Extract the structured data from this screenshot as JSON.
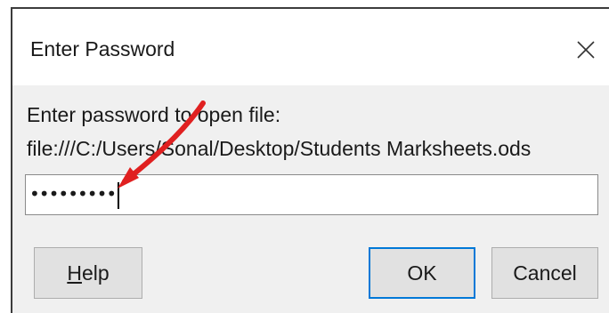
{
  "dialog": {
    "title": "Enter Password",
    "close_icon": "close-icon",
    "prompt": "Enter password to open file:",
    "file_path": "file:///C:/Users/Sonal/Desktop/Students Marksheets.ods",
    "password_value": "•••••••••",
    "buttons": {
      "help_first": "H",
      "help_rest": "elp",
      "ok": "OK",
      "cancel": "Cancel"
    }
  },
  "annotation": {
    "arrow_color": "#e02020"
  }
}
